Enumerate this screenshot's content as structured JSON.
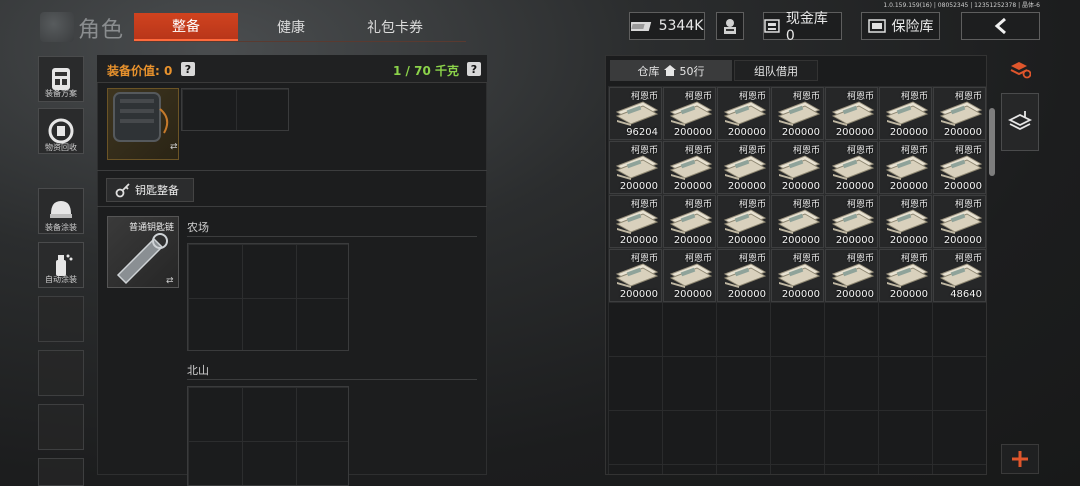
{
  "version_text": "1.0.159.159(16) | 08052345 | 12351252378 | 晶体-6",
  "page_title": "角色",
  "tabs": [
    {
      "label": "整备",
      "active": true
    },
    {
      "label": "健康",
      "active": false
    },
    {
      "label": "礼包卡券",
      "active": false
    }
  ],
  "header": {
    "money": "5344K",
    "cash_store_label": "现金库 0",
    "safe_label": "保险库"
  },
  "left_menu": [
    {
      "label": "装备方案",
      "icon": "tactical-gear-icon"
    },
    {
      "label": "物资回收",
      "icon": "recycle-icon"
    },
    {
      "label": "装备涂装",
      "icon": "helmet-paint-icon"
    },
    {
      "label": "自动涂装",
      "icon": "spray-can-icon"
    }
  ],
  "equip": {
    "value_label": "装备价值: 0",
    "weight_label": "1 / 70 千克",
    "key_section_label": "钥匙整备",
    "key_item_name": "普通钥匙链",
    "key_areas": [
      "农场",
      "北山"
    ]
  },
  "warehouse": {
    "tab_label": "仓库",
    "rows_label": "50行",
    "team_tab_label": "组队借用",
    "items": [
      {
        "name": "柯恩币",
        "amount": "96204"
      },
      {
        "name": "柯恩币",
        "amount": "200000"
      },
      {
        "name": "柯恩币",
        "amount": "200000"
      },
      {
        "name": "柯恩币",
        "amount": "200000"
      },
      {
        "name": "柯恩币",
        "amount": "200000"
      },
      {
        "name": "柯恩币",
        "amount": "200000"
      },
      {
        "name": "柯恩币",
        "amount": "200000"
      },
      {
        "name": "柯恩币",
        "amount": "200000"
      },
      {
        "name": "柯恩币",
        "amount": "200000"
      },
      {
        "name": "柯恩币",
        "amount": "200000"
      },
      {
        "name": "柯恩币",
        "amount": "200000"
      },
      {
        "name": "柯恩币",
        "amount": "200000"
      },
      {
        "name": "柯恩币",
        "amount": "200000"
      },
      {
        "name": "柯恩币",
        "amount": "200000"
      },
      {
        "name": "柯恩币",
        "amount": "200000"
      },
      {
        "name": "柯恩币",
        "amount": "200000"
      },
      {
        "name": "柯恩币",
        "amount": "200000"
      },
      {
        "name": "柯恩币",
        "amount": "200000"
      },
      {
        "name": "柯恩币",
        "amount": "200000"
      },
      {
        "name": "柯恩币",
        "amount": "200000"
      },
      {
        "name": "柯恩币",
        "amount": "200000"
      },
      {
        "name": "柯恩币",
        "amount": "200000"
      },
      {
        "name": "柯恩币",
        "amount": "200000"
      },
      {
        "name": "柯恩币",
        "amount": "200000"
      },
      {
        "name": "柯恩币",
        "amount": "200000"
      },
      {
        "name": "柯恩币",
        "amount": "200000"
      },
      {
        "name": "柯恩币",
        "amount": "200000"
      },
      {
        "name": "柯恩币",
        "amount": "48640"
      }
    ]
  },
  "colors": {
    "accent": "#d0431f",
    "value_orange": "#e8922d",
    "weight_green": "#8bd24a"
  }
}
